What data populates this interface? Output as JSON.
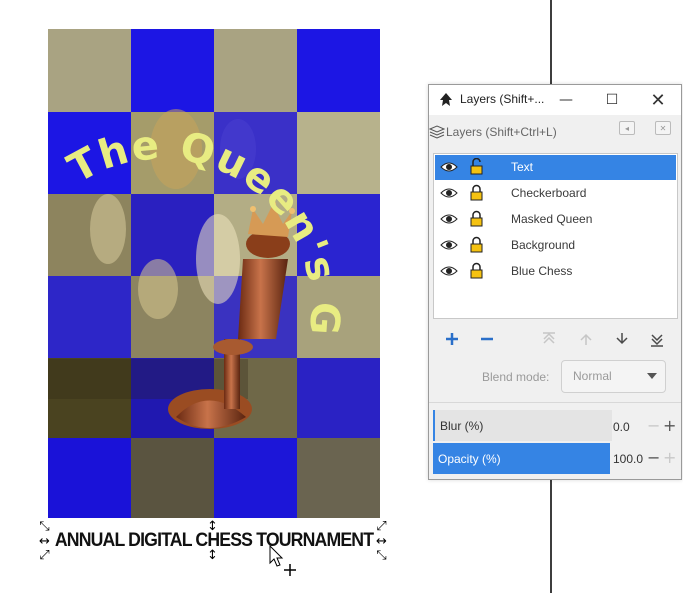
{
  "poster": {
    "headline": "The Queen's Gambit",
    "caption": "ANNUAL DIGITAL CHESS TOURNAMENT",
    "colors": {
      "blue": "#1b14e0",
      "tan": "#a9a382",
      "text": "#e8ec82"
    }
  },
  "dialog": {
    "title": "Layers (Shift+...",
    "panel_title": "Layers (Shift+Ctrl+L)",
    "layers": [
      {
        "name": "Text",
        "selected": true
      },
      {
        "name": "Checkerboard",
        "selected": false
      },
      {
        "name": "Masked Queen",
        "selected": false
      },
      {
        "name": "Background",
        "selected": false
      },
      {
        "name": "Blue Chess",
        "selected": false
      }
    ],
    "blend_label": "Blend mode:",
    "blend_value": "Normal",
    "blur": {
      "label": "Blur (%)",
      "value": "0.0"
    },
    "opacity": {
      "label": "Opacity (%)",
      "value": "100.0"
    },
    "accent": "#3584e4"
  }
}
